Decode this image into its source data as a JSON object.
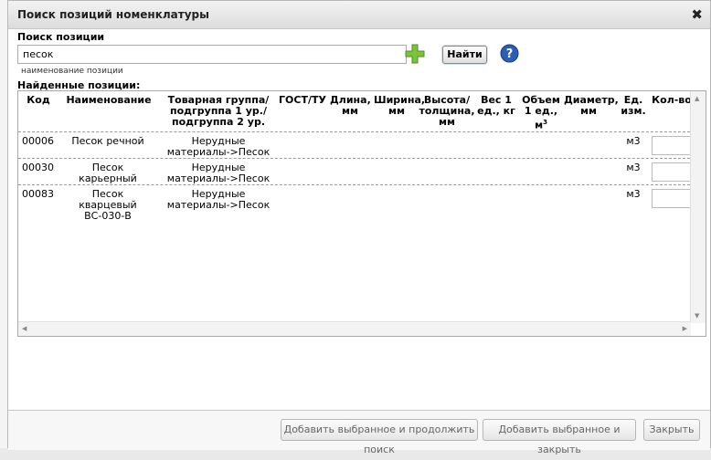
{
  "dialog": {
    "title": "Поиск позиций номенклатуры"
  },
  "search": {
    "label": "Поиск позиции",
    "value": "песок",
    "hint": "наименование позиции",
    "find_label": "Найти"
  },
  "results": {
    "label": "Найденные позиции:",
    "columns": [
      "Код",
      "Наименование",
      "Товарная группа/ подгруппа 1 ур./ подгруппа 2 ур.",
      "ГОСТ/ТУ",
      "Длина, мм",
      "Ширина, мм",
      "Высота/ толщина, мм",
      "Вес 1 ед., кг",
      "Объем 1 ед., м",
      "Диаметр, мм",
      "Ед. изм.",
      "Кол-во"
    ],
    "volume_unit_sup": "3",
    "rows": [
      {
        "code": "00006",
        "name": "Песок речной",
        "group": "Нерудные материалы->Песок",
        "unit": "м3",
        "qty": ""
      },
      {
        "code": "00030",
        "name": "Песок карьерный",
        "group": "Нерудные материалы->Песок",
        "unit": "м3",
        "qty": ""
      },
      {
        "code": "00083",
        "name": "Песок кварцевый ВС-030-В",
        "group": "Нерудные материалы->Песок",
        "unit": "м3",
        "qty": ""
      }
    ]
  },
  "footer": {
    "add_continue": "Добавить выбранное и продолжить поиск",
    "add_close": "Добавить выбранное и закрыть",
    "close": "Закрыть"
  }
}
